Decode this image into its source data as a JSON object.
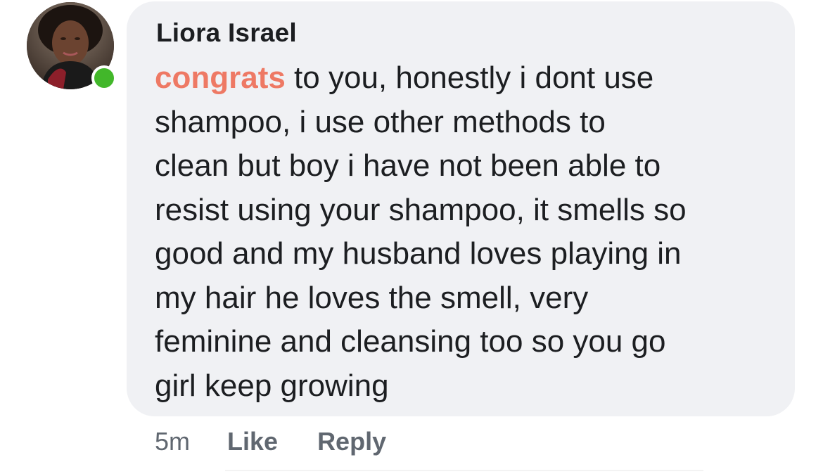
{
  "comment": {
    "author": "Liora Israel",
    "highlight": "congrats",
    "first_line_rest": " to you, honestly i dont use",
    "lines": [
      "shampoo, i use other methods to",
      "clean but boy i have not been able to",
      "resist using your shampoo, it smells so",
      "good and my husband loves playing in",
      "my hair he loves the smell, very",
      "feminine and cleansing too so you go",
      "girl keep growing"
    ],
    "timestamp": "5m",
    "like_label": "Like",
    "reply_label": "Reply"
  },
  "colors": {
    "bubble": "#f0f1f4",
    "highlight": "#ee7964",
    "presence": "#42b72a",
    "meta_text": "#606770"
  },
  "icons": {
    "online_status": "presence-dot-icon"
  }
}
